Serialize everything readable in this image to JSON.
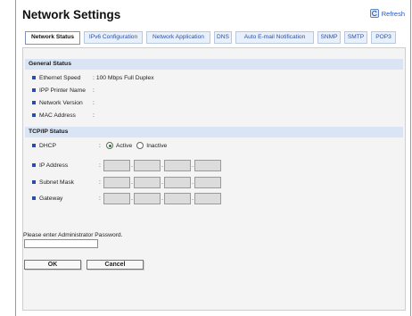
{
  "header": {
    "title": "Network Settings",
    "refresh_label": "Refresh"
  },
  "tabs": [
    {
      "label": "Network Status"
    },
    {
      "label": "IPv6 Configuration"
    },
    {
      "label": "Network Application"
    },
    {
      "label": "DNS"
    },
    {
      "label": "Auto E-mail Notification"
    },
    {
      "label": "SNMP"
    },
    {
      "label": "SMTP"
    },
    {
      "label": "POP3"
    }
  ],
  "general": {
    "heading": "General Status",
    "rows": [
      {
        "label": "Ethernet Speed",
        "value": "100 Mbps Full Duplex"
      },
      {
        "label": "IPP Printer Name",
        "value": ""
      },
      {
        "label": "Network Version",
        "value": ""
      },
      {
        "label": "MAC Address",
        "value": ""
      }
    ]
  },
  "tcpip": {
    "heading": "TCP/IP Status",
    "dhcp": {
      "label": "DHCP",
      "active_label": "Active",
      "inactive_label": "Inactive",
      "selected": "Active"
    },
    "ip_address_label": "IP Address",
    "subnet_mask_label": "Subnet Mask",
    "gateway_label": "Gateway",
    "separator": ":",
    "octet_dot": "."
  },
  "password": {
    "prompt": "Please enter Administrator Password.",
    "value": ""
  },
  "buttons": {
    "ok": "OK",
    "cancel": "Cancel"
  },
  "colors": {
    "section_bg": "#d9e4f5",
    "tab_bg": "#e8f0fb",
    "bullet": "#2a4da3",
    "link": "#2256c4"
  }
}
